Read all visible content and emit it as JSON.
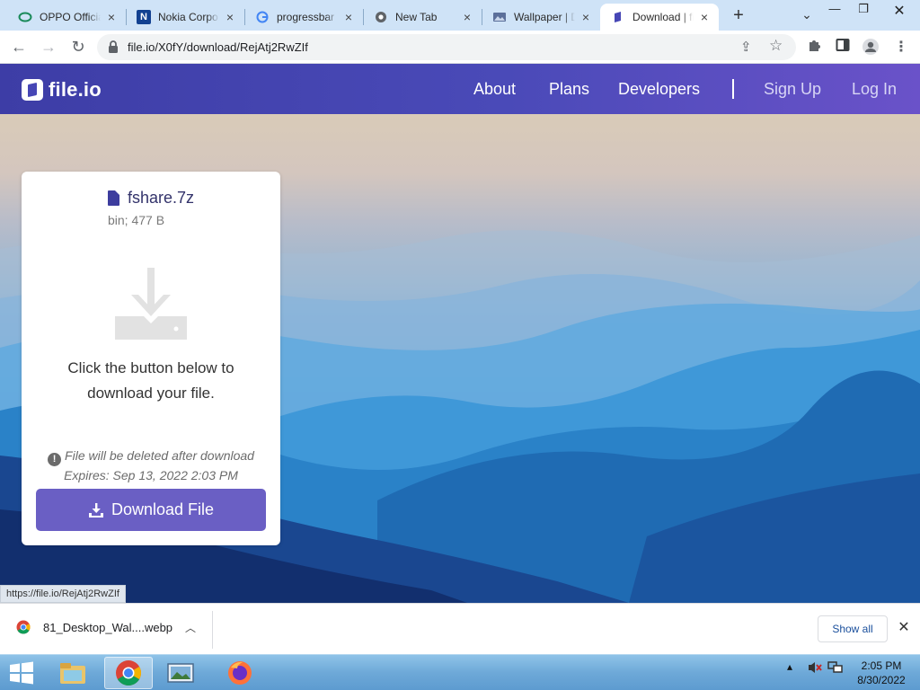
{
  "browser": {
    "tabs": [
      {
        "label": "OPPO Official",
        "icon": "oppo-ring-icon"
      },
      {
        "label": "Nokia Corporation",
        "icon": "nokia-n-icon"
      },
      {
        "label": "progressbar",
        "icon": "google-g-icon"
      },
      {
        "label": "New Tab",
        "icon": "chrome-icon"
      },
      {
        "label": "Wallpaper | Desktop",
        "icon": "wallpaper-icon"
      },
      {
        "label": "Download | file.io",
        "icon": "fileio-icon",
        "active": true
      }
    ],
    "url": "file.io/X0fY/download/RejAtj2RwZIf"
  },
  "site": {
    "brand": "file.io",
    "nav": {
      "about": "About",
      "plans": "Plans",
      "developers": "Developers",
      "signup": "Sign Up",
      "login": "Log In"
    },
    "accent": "#4a4ab8",
    "button_color": "#6a5fc4"
  },
  "card": {
    "filename": "fshare.7z",
    "meta": "bin; 477 B",
    "instruction_line1": "Click the button below to",
    "instruction_line2": "download your file.",
    "warning": "File will be deleted after download",
    "expires": "Expires: Sep 13, 2022 2:03 PM",
    "button": "Download File"
  },
  "status_url": "https://file.io/RejAtj2RwZIf",
  "download_shelf": {
    "filename": "81_Desktop_Wal....webp",
    "show_all": "Show all"
  },
  "taskbar": {
    "time": "2:05 PM",
    "date": "8/30/2022"
  }
}
